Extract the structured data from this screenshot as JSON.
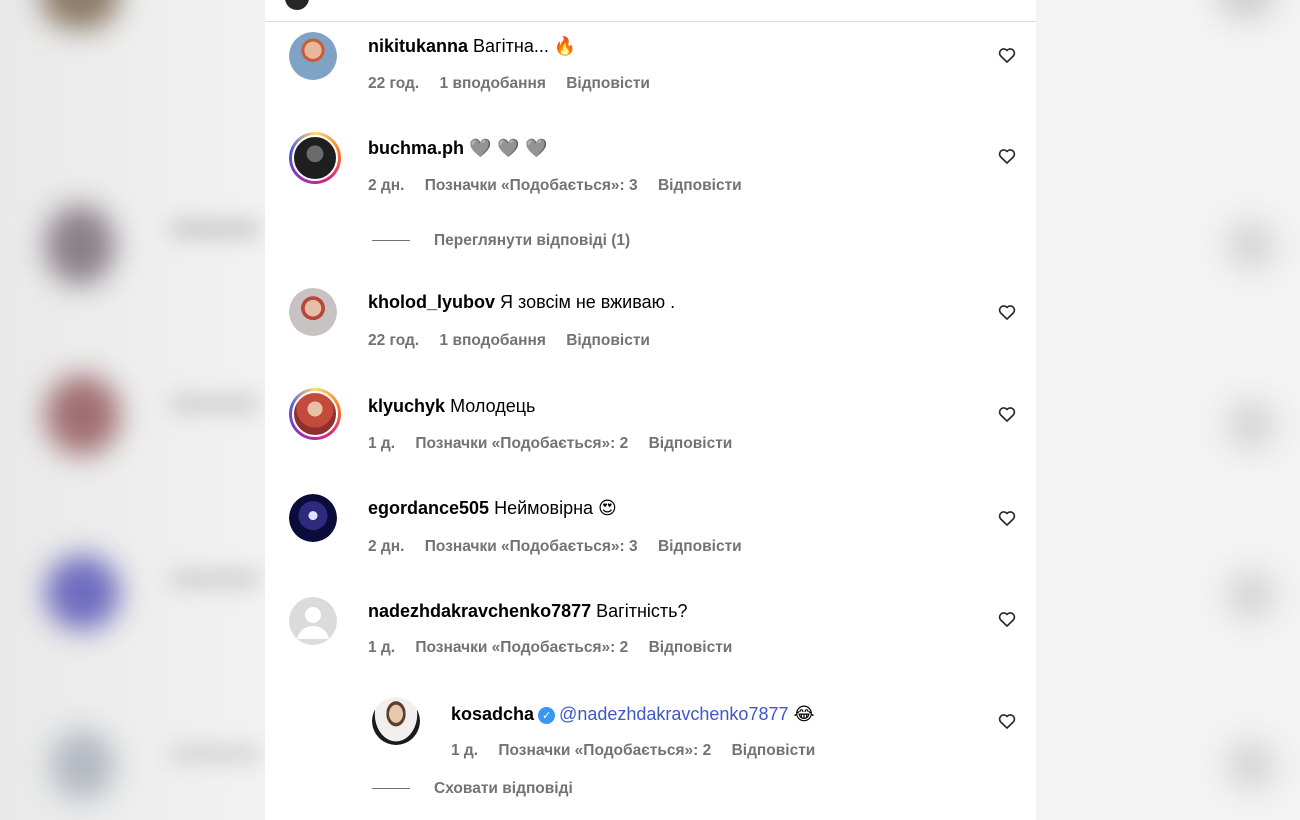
{
  "comments": [
    {
      "username": "nikitukanna",
      "text": "Вагітна... 🔥",
      "time": "22 год.",
      "likes": "1 вподобання",
      "reply": "Відповісти",
      "avatar": {
        "ring": false,
        "bg": "#8aa6c2"
      }
    },
    {
      "username": "buchma.ph",
      "text": "🩶 🩶 🩶",
      "time": "2 дн.",
      "likes": "Позначки «Подобається»: 3",
      "reply": "Відповісти",
      "avatar": {
        "ring": true,
        "bg": "#3a3a3a"
      },
      "view_replies": "Переглянути відповіді (1)"
    },
    {
      "username": "kholod_lyubov",
      "text": "Я зовсім не вживаю .",
      "time": "22 год.",
      "likes": "1 вподобання",
      "reply": "Відповісти",
      "avatar": {
        "ring": false,
        "bg": "#b7a59a"
      }
    },
    {
      "username": "klyuchyk",
      "text": "Молодець",
      "time": "1 д.",
      "likes": "Позначки «Подобається»: 2",
      "reply": "Відповісти",
      "avatar": {
        "ring": true,
        "bg": "#9b3a3a"
      }
    },
    {
      "username": "egordance505",
      "text": "Неймовірна 😍",
      "time": "2 дн.",
      "likes": "Позначки «Подобається»: 3",
      "reply": "Відповісти",
      "avatar": {
        "ring": false,
        "bg": "#3b3fb8"
      }
    },
    {
      "username": "nadezhdakravchenko7877",
      "text": "Вагітність?",
      "time": "1 д.",
      "likes": "Позначки «Подобається»: 2",
      "reply": "Відповісти",
      "avatar": {
        "ring": false,
        "bg": "#dbdbdb",
        "default": true
      }
    },
    {
      "username": "kosadcha",
      "verified": true,
      "mention": "@nadezhdakravchenko7877",
      "text": "😂",
      "time": "1 д.",
      "likes": "Позначки «Подобається»: 2",
      "reply": "Відповісти",
      "avatar": {
        "ring": false,
        "bg": "#e8e2dc"
      },
      "hide_replies": "Сховати відповіді"
    }
  ],
  "colors": {
    "link": "#3d58c8",
    "meta": "#737373",
    "verified": "#3897f0"
  }
}
